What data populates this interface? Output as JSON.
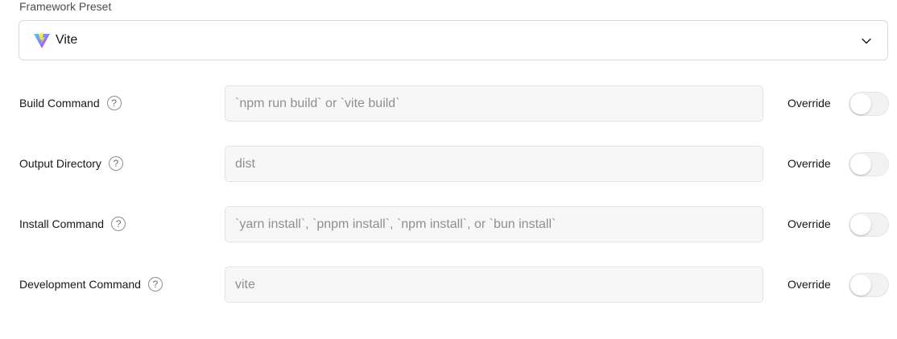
{
  "framework_preset": {
    "label": "Framework Preset",
    "selected": "Vite",
    "icon": "vite-logo-icon"
  },
  "settings": [
    {
      "label": "Build Command",
      "placeholder": "`npm run build` or `vite build`",
      "override_label": "Override",
      "override_enabled": false
    },
    {
      "label": "Output Directory",
      "placeholder": "dist",
      "override_label": "Override",
      "override_enabled": false
    },
    {
      "label": "Install Command",
      "placeholder": "`yarn install`, `pnpm install`, `npm install`, or `bun install`",
      "override_label": "Override",
      "override_enabled": false
    },
    {
      "label": "Development Command",
      "placeholder": "vite",
      "override_label": "Override",
      "override_enabled": false
    }
  ],
  "help_glyph": "?"
}
